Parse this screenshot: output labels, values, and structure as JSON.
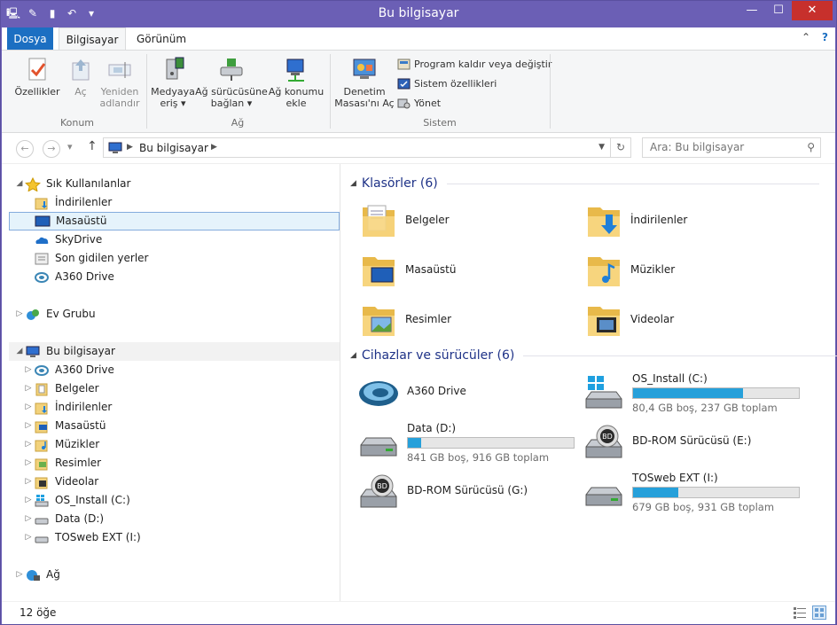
{
  "window": {
    "title": "Bu bilgisayar",
    "accent": "#6b5fb5"
  },
  "title_buttons": {
    "minimize": "—",
    "maximize": "☐",
    "close": "✕"
  },
  "ribbon_tabs": {
    "file": "Dosya",
    "computer": "Bilgisayar",
    "view": "Görünüm"
  },
  "ribbon": {
    "properties": "Özellikler",
    "open": "Aç",
    "rename_l1": "Yeniden",
    "rename_l2": "adlandır",
    "media_l1": "Medyaya",
    "media_l2": "eriş ▾",
    "mapdrive_l1": "Ağ sürücüsüne",
    "mapdrive_l2": "bağlan ▾",
    "addnet_l1": "Ağ konumu",
    "addnet_l2": "ekle",
    "cpanel_l1": "Denetim",
    "cpanel_l2": "Masası'nı Aç",
    "uninstall": "Program kaldır veya değiştir",
    "sysprops": "Sistem özellikleri",
    "manage": "Yönet",
    "group_location": "Konum",
    "group_network": "Ağ",
    "group_system": "Sistem"
  },
  "address": {
    "path": "Bu bilgisayar",
    "search_placeholder": "Ara: Bu bilgisayar"
  },
  "nav": {
    "favorites": "Sık Kullanılanlar",
    "downloads": "İndirilenler",
    "desktop": "Masaüstü",
    "skydrive": "SkyDrive",
    "recent": "Son gidilen yerler",
    "a360": "A360 Drive",
    "homegroup": "Ev Grubu",
    "thispc": "Bu bilgisayar",
    "pc_a360": "A360 Drive",
    "pc_documents": "Belgeler",
    "pc_downloads": "İndirilenler",
    "pc_desktop": "Masaüstü",
    "pc_music": "Müzikler",
    "pc_pictures": "Resimler",
    "pc_videos": "Videolar",
    "pc_osinstall": "OS_Install (C:)",
    "pc_data": "Data (D:)",
    "pc_tosweb": "TOSweb EXT (I:)",
    "network": "Ağ"
  },
  "folders": {
    "header": "Klasörler (6)",
    "items": [
      "Belgeler",
      "İndirilenler",
      "Masaüstü",
      "Müzikler",
      "Resimler",
      "Videolar"
    ]
  },
  "devices": {
    "header": "Cihazlar ve sürücüler (6)",
    "a360": {
      "name": "A360 Drive"
    },
    "c": {
      "name": "OS_Install (C:)",
      "free": "80,4 GB boş, 237 GB toplam",
      "used_fraction": 0.661
    },
    "d": {
      "name": "Data (D:)",
      "free": "841 GB boş, 916 GB toplam",
      "used_fraction": 0.082
    },
    "e": {
      "name": "BD-ROM Sürücüsü (E:)"
    },
    "g": {
      "name": "BD-ROM Sürücüsü (G:)"
    },
    "i": {
      "name": "TOSweb EXT (I:)",
      "free": "679 GB boş, 931 GB toplam",
      "used_fraction": 0.271
    }
  },
  "status": {
    "count": "12 öğe"
  }
}
